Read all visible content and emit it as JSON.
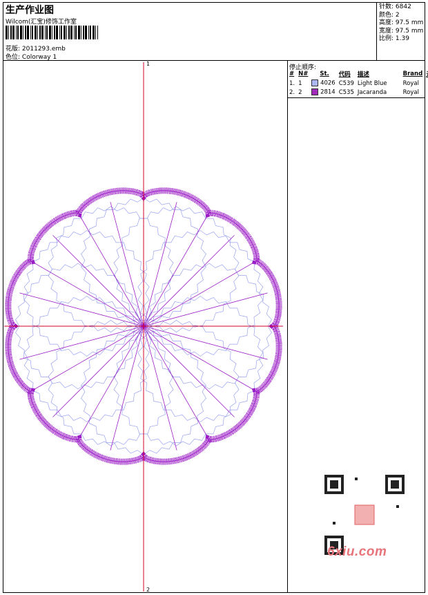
{
  "header": {
    "title": "生产作业图",
    "studio": "Wilcom(汇宝)修饰工作室",
    "design_label": "花版:",
    "design_value": "2011293.emb",
    "colorway_label": "色位:",
    "colorway_value": "Colorway 1"
  },
  "stats": [
    {
      "label": "针数:",
      "value": "6842"
    },
    {
      "label": "颜色:",
      "value": "2"
    },
    {
      "label": "高度:",
      "value": "97.5 mm"
    },
    {
      "label": "宽度:",
      "value": "97.5 mm"
    },
    {
      "label": "比例:",
      "value": "1.39"
    }
  ],
  "stops": {
    "title": "停止顺序:",
    "columns": [
      "#",
      "N#",
      "St.",
      "代码",
      "描述",
      "Brand",
      "元素"
    ],
    "rows": [
      {
        "index": "1.",
        "n": "1",
        "color": "#a9b7f5",
        "st": "4026",
        "code": "C539",
        "desc": "Light Blue",
        "brand": "Royal"
      },
      {
        "index": "2.",
        "n": "2",
        "color": "#9e2ab8",
        "st": "2814",
        "code": "C535",
        "desc": "Jacaranda",
        "brand": "Royal"
      }
    ]
  },
  "axis": {
    "top": "1",
    "bottom": "2"
  },
  "watermark": "6xiu.com",
  "colors": {
    "axis": "#d4002a",
    "outline": "#9b1ec6",
    "fill": "#9aa2ee"
  }
}
